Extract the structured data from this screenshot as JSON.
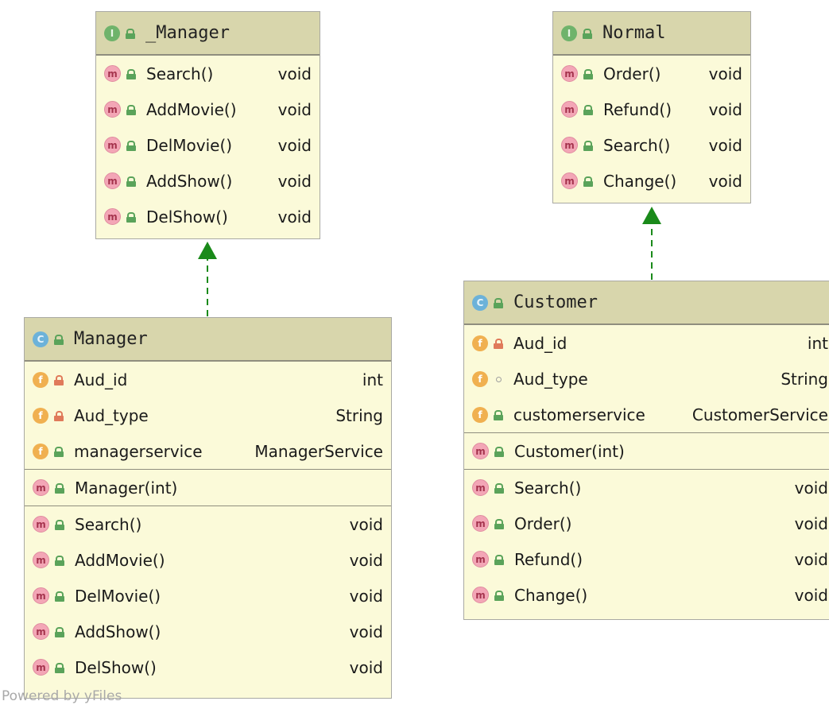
{
  "classes": {
    "manager_interface": {
      "badge": "I",
      "name": "_Manager",
      "methods": [
        {
          "name": "Search()",
          "type": "void"
        },
        {
          "name": "AddMovie()",
          "type": "void"
        },
        {
          "name": "DelMovie()",
          "type": "void"
        },
        {
          "name": "AddShow()",
          "type": "void"
        },
        {
          "name": "DelShow()",
          "type": "void"
        }
      ]
    },
    "normal_interface": {
      "badge": "I",
      "name": "Normal",
      "methods": [
        {
          "name": "Order()",
          "type": "void"
        },
        {
          "name": "Refund()",
          "type": "void"
        },
        {
          "name": "Search()",
          "type": "void"
        },
        {
          "name": "Change()",
          "type": "void"
        }
      ]
    },
    "manager_class": {
      "badge": "C",
      "name": "Manager",
      "fields": [
        {
          "name": "Aud_id",
          "type": "int",
          "visibility": "private"
        },
        {
          "name": "Aud_type",
          "type": "String",
          "visibility": "private"
        },
        {
          "name": "managerservice",
          "type": "ManagerService",
          "visibility": "public"
        }
      ],
      "constructors": [
        {
          "name": "Manager(int)",
          "type": ""
        }
      ],
      "methods": [
        {
          "name": "Search()",
          "type": "void"
        },
        {
          "name": "AddMovie()",
          "type": "void"
        },
        {
          "name": "DelMovie()",
          "type": "void"
        },
        {
          "name": "AddShow()",
          "type": "void"
        },
        {
          "name": "DelShow()",
          "type": "void"
        }
      ]
    },
    "customer_class": {
      "badge": "C",
      "name": "Customer",
      "fields": [
        {
          "name": "Aud_id",
          "type": "int",
          "visibility": "private"
        },
        {
          "name": "Aud_type",
          "type": "String",
          "visibility": "package"
        },
        {
          "name": "customerservice",
          "type": "CustomerService",
          "visibility": "public"
        }
      ],
      "constructors": [
        {
          "name": "Customer(int)",
          "type": ""
        }
      ],
      "methods": [
        {
          "name": "Search()",
          "type": "void"
        },
        {
          "name": "Order()",
          "type": "void"
        },
        {
          "name": "Refund()",
          "type": "void"
        },
        {
          "name": "Change()",
          "type": "void"
        }
      ]
    }
  },
  "member_badges": {
    "method": "m",
    "field": "f"
  },
  "footer": "Powered by yFiles",
  "colors": {
    "node_fill": "#fbfad9",
    "header_fill": "#d8d6ac",
    "arrow": "#1a8a1a"
  }
}
